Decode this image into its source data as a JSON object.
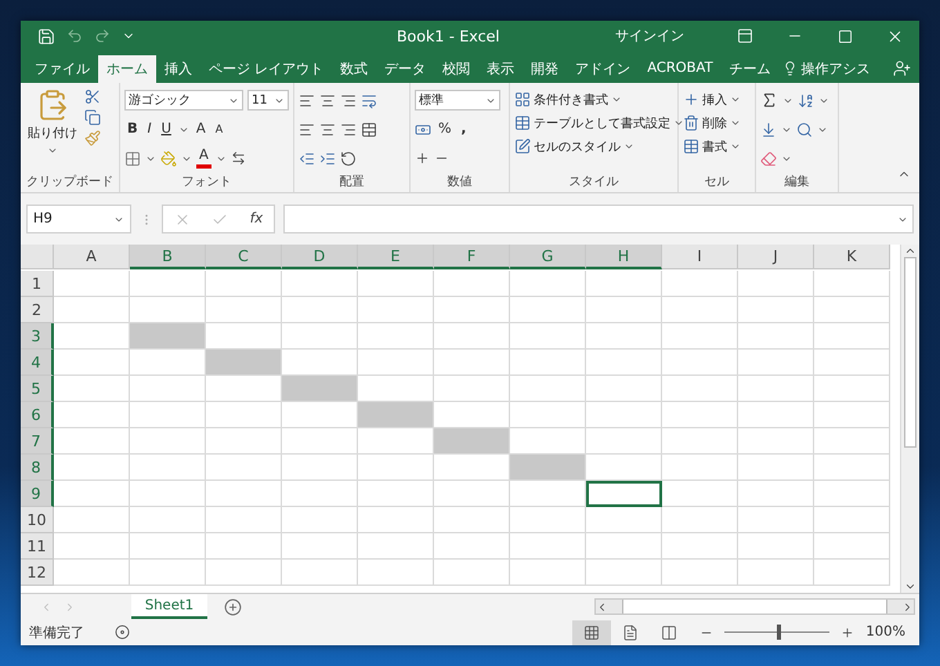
{
  "window": {
    "title": "Book1  -  Excel",
    "sign_in": "サインイン"
  },
  "tabs": [
    {
      "label": "ファイル",
      "selected": false
    },
    {
      "label": "ホーム",
      "selected": true
    },
    {
      "label": "挿入",
      "selected": false
    },
    {
      "label": "ページ レイアウト",
      "selected": false
    },
    {
      "label": "数式",
      "selected": false
    },
    {
      "label": "データ",
      "selected": false
    },
    {
      "label": "校閲",
      "selected": false
    },
    {
      "label": "表示",
      "selected": false
    },
    {
      "label": "開発",
      "selected": false
    },
    {
      "label": "アドイン",
      "selected": false
    },
    {
      "label": "ACROBAT",
      "selected": false
    },
    {
      "label": "チーム",
      "selected": false
    }
  ],
  "tell_me": "操作アシス",
  "ribbon": {
    "clipboard": {
      "paste": "貼り付け",
      "label": "クリップボード"
    },
    "font": {
      "name": "游ゴシック",
      "size": "11",
      "bold": "B",
      "italic": "I",
      "underline": "U",
      "grow": "A",
      "shrink": "A",
      "color_button": "A",
      "label": "フォント"
    },
    "alignment": {
      "label": "配置"
    },
    "number": {
      "format": "標準",
      "percent": "%",
      "comma": ",",
      "label": "数値"
    },
    "styles": {
      "items": [
        "条件付き書式",
        "テーブルとして書式設定",
        "セルのスタイル"
      ],
      "label": "スタイル"
    },
    "cells": {
      "items": [
        "挿入",
        "削除",
        "書式"
      ],
      "label": "セル"
    },
    "editing": {
      "label": "編集"
    }
  },
  "formula_bar": {
    "name_box": "H9",
    "function_label": "fx"
  },
  "grid": {
    "columns": [
      {
        "label": "A",
        "highlighted": false
      },
      {
        "label": "B",
        "highlighted": true
      },
      {
        "label": "C",
        "highlighted": true
      },
      {
        "label": "D",
        "highlighted": true
      },
      {
        "label": "E",
        "highlighted": true
      },
      {
        "label": "F",
        "highlighted": true
      },
      {
        "label": "G",
        "highlighted": true
      },
      {
        "label": "H",
        "highlighted": true
      },
      {
        "label": "I",
        "highlighted": false
      },
      {
        "label": "J",
        "highlighted": false
      },
      {
        "label": "K",
        "highlighted": false
      }
    ],
    "rows": [
      {
        "label": "1",
        "highlighted": false,
        "cells": [
          {
            "filled": false,
            "selected": false
          },
          {
            "filled": false,
            "selected": false
          },
          {
            "filled": false,
            "selected": false
          },
          {
            "filled": false,
            "selected": false
          },
          {
            "filled": false,
            "selected": false
          },
          {
            "filled": false,
            "selected": false
          },
          {
            "filled": false,
            "selected": false
          },
          {
            "filled": false,
            "selected": false
          },
          {
            "filled": false,
            "selected": false
          },
          {
            "filled": false,
            "selected": false
          },
          {
            "filled": false,
            "selected": false
          }
        ]
      },
      {
        "label": "2",
        "highlighted": false,
        "cells": [
          {
            "filled": false,
            "selected": false
          },
          {
            "filled": false,
            "selected": false
          },
          {
            "filled": false,
            "selected": false
          },
          {
            "filled": false,
            "selected": false
          },
          {
            "filled": false,
            "selected": false
          },
          {
            "filled": false,
            "selected": false
          },
          {
            "filled": false,
            "selected": false
          },
          {
            "filled": false,
            "selected": false
          },
          {
            "filled": false,
            "selected": false
          },
          {
            "filled": false,
            "selected": false
          },
          {
            "filled": false,
            "selected": false
          }
        ]
      },
      {
        "label": "3",
        "highlighted": true,
        "cells": [
          {
            "filled": false,
            "selected": false
          },
          {
            "filled": true,
            "selected": false
          },
          {
            "filled": false,
            "selected": false
          },
          {
            "filled": false,
            "selected": false
          },
          {
            "filled": false,
            "selected": false
          },
          {
            "filled": false,
            "selected": false
          },
          {
            "filled": false,
            "selected": false
          },
          {
            "filled": false,
            "selected": false
          },
          {
            "filled": false,
            "selected": false
          },
          {
            "filled": false,
            "selected": false
          },
          {
            "filled": false,
            "selected": false
          }
        ]
      },
      {
        "label": "4",
        "highlighted": true,
        "cells": [
          {
            "filled": false,
            "selected": false
          },
          {
            "filled": false,
            "selected": false
          },
          {
            "filled": true,
            "selected": false
          },
          {
            "filled": false,
            "selected": false
          },
          {
            "filled": false,
            "selected": false
          },
          {
            "filled": false,
            "selected": false
          },
          {
            "filled": false,
            "selected": false
          },
          {
            "filled": false,
            "selected": false
          },
          {
            "filled": false,
            "selected": false
          },
          {
            "filled": false,
            "selected": false
          },
          {
            "filled": false,
            "selected": false
          }
        ]
      },
      {
        "label": "5",
        "highlighted": true,
        "cells": [
          {
            "filled": false,
            "selected": false
          },
          {
            "filled": false,
            "selected": false
          },
          {
            "filled": false,
            "selected": false
          },
          {
            "filled": true,
            "selected": false
          },
          {
            "filled": false,
            "selected": false
          },
          {
            "filled": false,
            "selected": false
          },
          {
            "filled": false,
            "selected": false
          },
          {
            "filled": false,
            "selected": false
          },
          {
            "filled": false,
            "selected": false
          },
          {
            "filled": false,
            "selected": false
          },
          {
            "filled": false,
            "selected": false
          }
        ]
      },
      {
        "label": "6",
        "highlighted": true,
        "cells": [
          {
            "filled": false,
            "selected": false
          },
          {
            "filled": false,
            "selected": false
          },
          {
            "filled": false,
            "selected": false
          },
          {
            "filled": false,
            "selected": false
          },
          {
            "filled": true,
            "selected": false
          },
          {
            "filled": false,
            "selected": false
          },
          {
            "filled": false,
            "selected": false
          },
          {
            "filled": false,
            "selected": false
          },
          {
            "filled": false,
            "selected": false
          },
          {
            "filled": false,
            "selected": false
          },
          {
            "filled": false,
            "selected": false
          }
        ]
      },
      {
        "label": "7",
        "highlighted": true,
        "cells": [
          {
            "filled": false,
            "selected": false
          },
          {
            "filled": false,
            "selected": false
          },
          {
            "filled": false,
            "selected": false
          },
          {
            "filled": false,
            "selected": false
          },
          {
            "filled": false,
            "selected": false
          },
          {
            "filled": true,
            "selected": false
          },
          {
            "filled": false,
            "selected": false
          },
          {
            "filled": false,
            "selected": false
          },
          {
            "filled": false,
            "selected": false
          },
          {
            "filled": false,
            "selected": false
          },
          {
            "filled": false,
            "selected": false
          }
        ]
      },
      {
        "label": "8",
        "highlighted": true,
        "cells": [
          {
            "filled": false,
            "selected": false
          },
          {
            "filled": false,
            "selected": false
          },
          {
            "filled": false,
            "selected": false
          },
          {
            "filled": false,
            "selected": false
          },
          {
            "filled": false,
            "selected": false
          },
          {
            "filled": false,
            "selected": false
          },
          {
            "filled": true,
            "selected": false
          },
          {
            "filled": false,
            "selected": false
          },
          {
            "filled": false,
            "selected": false
          },
          {
            "filled": false,
            "selected": false
          },
          {
            "filled": false,
            "selected": false
          }
        ]
      },
      {
        "label": "9",
        "highlighted": true,
        "cells": [
          {
            "filled": false,
            "selected": false
          },
          {
            "filled": false,
            "selected": false
          },
          {
            "filled": false,
            "selected": false
          },
          {
            "filled": false,
            "selected": false
          },
          {
            "filled": false,
            "selected": false
          },
          {
            "filled": false,
            "selected": false
          },
          {
            "filled": false,
            "selected": false
          },
          {
            "filled": false,
            "selected": true
          },
          {
            "filled": false,
            "selected": false
          },
          {
            "filled": false,
            "selected": false
          },
          {
            "filled": false,
            "selected": false
          }
        ]
      },
      {
        "label": "10",
        "highlighted": false,
        "cells": [
          {
            "filled": false,
            "selected": false
          },
          {
            "filled": false,
            "selected": false
          },
          {
            "filled": false,
            "selected": false
          },
          {
            "filled": false,
            "selected": false
          },
          {
            "filled": false,
            "selected": false
          },
          {
            "filled": false,
            "selected": false
          },
          {
            "filled": false,
            "selected": false
          },
          {
            "filled": false,
            "selected": false
          },
          {
            "filled": false,
            "selected": false
          },
          {
            "filled": false,
            "selected": false
          },
          {
            "filled": false,
            "selected": false
          }
        ]
      },
      {
        "label": "11",
        "highlighted": false,
        "cells": [
          {
            "filled": false,
            "selected": false
          },
          {
            "filled": false,
            "selected": false
          },
          {
            "filled": false,
            "selected": false
          },
          {
            "filled": false,
            "selected": false
          },
          {
            "filled": false,
            "selected": false
          },
          {
            "filled": false,
            "selected": false
          },
          {
            "filled": false,
            "selected": false
          },
          {
            "filled": false,
            "selected": false
          },
          {
            "filled": false,
            "selected": false
          },
          {
            "filled": false,
            "selected": false
          },
          {
            "filled": false,
            "selected": false
          }
        ]
      },
      {
        "label": "12",
        "highlighted": false,
        "cells": [
          {
            "filled": false,
            "selected": false
          },
          {
            "filled": false,
            "selected": false
          },
          {
            "filled": false,
            "selected": false
          },
          {
            "filled": false,
            "selected": false
          },
          {
            "filled": false,
            "selected": false
          },
          {
            "filled": false,
            "selected": false
          },
          {
            "filled": false,
            "selected": false
          },
          {
            "filled": false,
            "selected": false
          },
          {
            "filled": false,
            "selected": false
          },
          {
            "filled": false,
            "selected": false
          },
          {
            "filled": false,
            "selected": false
          }
        ]
      }
    ]
  },
  "sheets": [
    {
      "label": "Sheet1",
      "selected": true
    }
  ],
  "status_bar": {
    "text": "準備完了",
    "views": [
      {
        "kind": "normal",
        "selected": true
      },
      {
        "kind": "layout",
        "selected": false
      },
      {
        "kind": "pagebreak",
        "selected": false
      }
    ],
    "zoom": {
      "level": 0.5,
      "reading": "100%"
    }
  }
}
